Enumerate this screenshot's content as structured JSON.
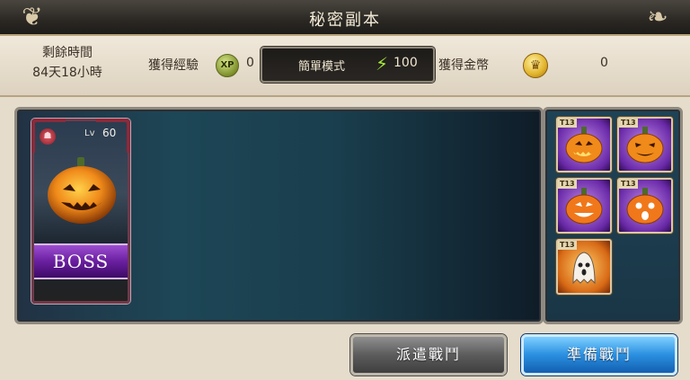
{
  "header": {
    "title": "秘密副本"
  },
  "info": {
    "remaining_label": "剩餘時間",
    "remaining_value": "84天18小時",
    "xp_label": "獲得經驗",
    "xp_icon_text": "XP",
    "xp_value": "0",
    "mode_label": "簡單模式",
    "mode_value": "100",
    "gold_label": "獲得金幣",
    "gold_value": "0"
  },
  "boss_card": {
    "lv_label": "Lv",
    "lv_value": "60",
    "banner": "BOSS"
  },
  "rewards": [
    {
      "tag": "T13",
      "frame": "purple",
      "icon": "jack-o-lantern-icon"
    },
    {
      "tag": "T13",
      "frame": "purple",
      "icon": "jack-o-lantern-icon"
    },
    {
      "tag": "T13",
      "frame": "purple",
      "icon": "jack-o-lantern-icon"
    },
    {
      "tag": "T13",
      "frame": "purple",
      "icon": "jack-o-lantern-icon"
    },
    {
      "tag": "T13",
      "frame": "orange",
      "icon": "ghost-pumpkin-icon"
    }
  ],
  "buttons": {
    "dispatch": "派遣戰鬥",
    "prepare": "準備戰鬥"
  },
  "colors": {
    "prepare_button": "#2a8fe0",
    "dispatch_button": "#5c5c5c",
    "boss_banner": "#6a1fa0"
  }
}
